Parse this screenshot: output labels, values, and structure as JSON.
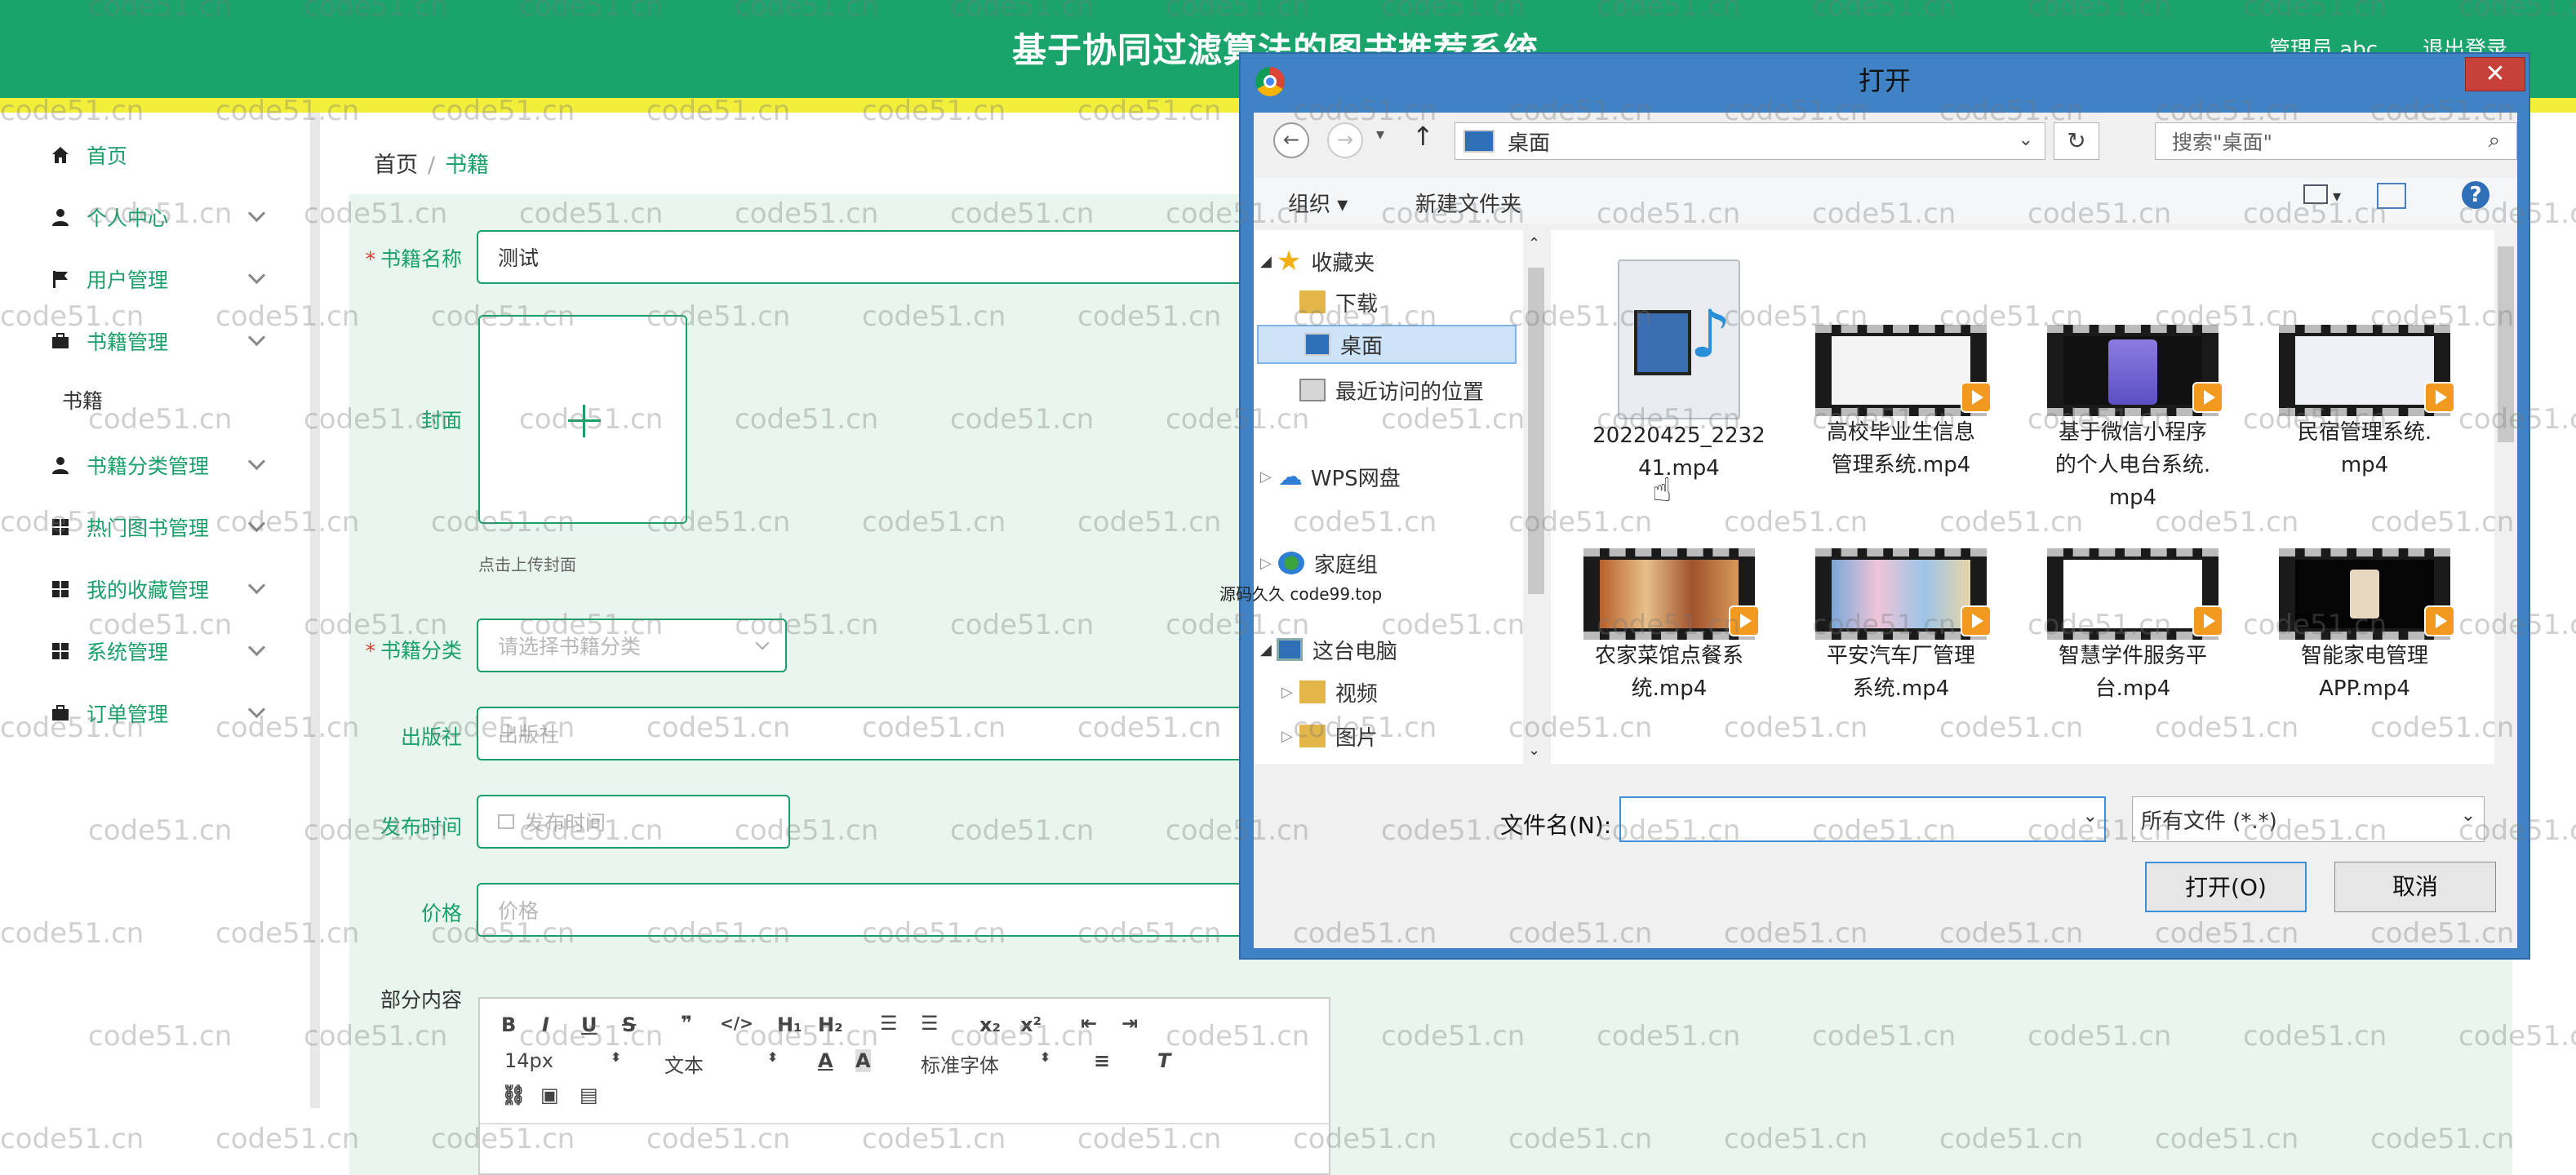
{
  "header": {
    "title": "基于协同过滤算法的图书推荐系统",
    "admin_label": "管理员 abc",
    "logout_label": "退出登录"
  },
  "sidebar": {
    "items": [
      {
        "label": "首页",
        "icon": "home-icon"
      },
      {
        "label": "个人中心",
        "icon": "user-icon"
      },
      {
        "label": "用户管理",
        "icon": "flag-icon"
      },
      {
        "label": "书籍管理",
        "icon": "briefcase-icon"
      },
      {
        "label": "书籍分类管理",
        "icon": "user-icon"
      },
      {
        "label": "热门图书管理",
        "icon": "grid-icon"
      },
      {
        "label": "我的收藏管理",
        "icon": "grid-icon"
      },
      {
        "label": "系统管理",
        "icon": "grid-icon"
      },
      {
        "label": "订单管理",
        "icon": "briefcase-icon"
      }
    ],
    "sub_item": "书籍"
  },
  "breadcrumb": {
    "home": "首页",
    "sep": "/",
    "current": "书籍"
  },
  "form": {
    "name_label": "书籍名称",
    "name_value": "测试",
    "cover_label": "封面",
    "cover_hint": "点击上传封面",
    "category_label": "书籍分类",
    "category_placeholder": "请选择书籍分类",
    "publisher_label": "出版社",
    "publisher_placeholder": "出版社",
    "date_label": "发布时间",
    "date_placeholder": "发布时间",
    "price_label": "价格",
    "price_placeholder": "价格",
    "content_label": "部分内容",
    "editor_font_size": "14px",
    "editor_text_style": "文本",
    "editor_font": "标准字体"
  },
  "dialog": {
    "title": "打开",
    "close": "✕",
    "address": "桌面",
    "search_placeholder": "搜索\"桌面\"",
    "organize": "组织 ▾",
    "new_folder": "新建文件夹",
    "tree": [
      {
        "label": "收藏夹",
        "icon": "star-icon"
      },
      {
        "label": "下载",
        "icon": "download-folder-icon"
      },
      {
        "label": "桌面",
        "icon": "desktop-icon"
      },
      {
        "label": "最近访问的位置",
        "icon": "recent-places-icon"
      },
      {
        "label": "WPS网盘",
        "icon": "cloud-icon"
      },
      {
        "label": "家庭组",
        "icon": "homegroup-icon"
      },
      {
        "label": "这台电脑",
        "icon": "computer-icon"
      },
      {
        "label": "视频",
        "icon": "video-folder-icon"
      },
      {
        "label": "图片",
        "icon": "picture-folder-icon"
      }
    ],
    "files": [
      {
        "line1": "20220425_2232",
        "line2": "41.mp4",
        "line3": "",
        "kind": "audio"
      },
      {
        "line1": "高校毕业生信息",
        "line2": "管理系统.mp4",
        "line3": "",
        "kind": "video-light"
      },
      {
        "line1": "基于微信小程序",
        "line2": "的个人电台系统.",
        "line3": "mp4",
        "kind": "video-phone"
      },
      {
        "line1": "民宿管理系统.",
        "line2": "mp4",
        "line3": "",
        "kind": "video-light"
      },
      {
        "line1": "农家菜馆点餐系",
        "line2": "统.mp4",
        "line3": "",
        "kind": "video-food"
      },
      {
        "line1": "平安汽车厂管理",
        "line2": "系统.mp4",
        "line3": "",
        "kind": "video-grid"
      },
      {
        "line1": "智慧学件服务平",
        "line2": "台.mp4",
        "line3": "",
        "kind": "video-white"
      },
      {
        "line1": "智能家电管理",
        "line2": "APP.mp4",
        "line3": "",
        "kind": "video-dark"
      }
    ],
    "filename_label": "文件名(N):",
    "filetype": "所有文件 (*.*)",
    "open_button": "打开(O)",
    "cancel_button": "取消"
  },
  "overlay_caption": "源码久久 code99.top",
  "watermark": "code51.cn",
  "colors": {
    "brand_green": "#1aa36a",
    "accent_yellow": "#f2ef3a",
    "dialog_blue": "#3f82c6"
  }
}
